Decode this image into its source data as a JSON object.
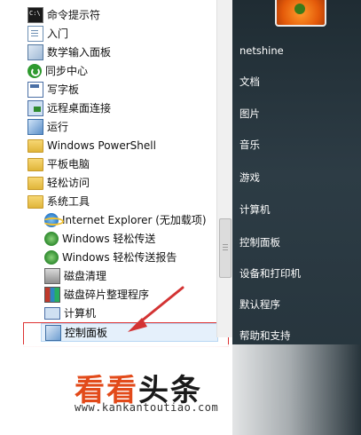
{
  "programs": [
    {
      "label": "命令提示符",
      "icon": "command-prompt-icon"
    },
    {
      "label": "入门",
      "icon": "getting-started-icon"
    },
    {
      "label": "数学输入面板",
      "icon": "math-input-panel-icon"
    },
    {
      "label": "同步中心",
      "icon": "sync-center-icon"
    },
    {
      "label": "写字板",
      "icon": "wordpad-icon"
    },
    {
      "label": "远程桌面连接",
      "icon": "remote-desktop-icon"
    },
    {
      "label": "运行",
      "icon": "run-icon"
    },
    {
      "label": "Windows PowerShell",
      "icon": "folder-icon"
    },
    {
      "label": "平板电脑",
      "icon": "folder-icon"
    },
    {
      "label": "轻松访问",
      "icon": "folder-icon"
    },
    {
      "label": "系统工具",
      "icon": "folder-icon"
    },
    {
      "label": "Internet Explorer (无加载项)",
      "icon": "internet-explorer-icon"
    },
    {
      "label": "Windows 轻松传送",
      "icon": "easy-transfer-icon"
    },
    {
      "label": "Windows 轻松传送报告",
      "icon": "easy-transfer-reports-icon"
    },
    {
      "label": "磁盘清理",
      "icon": "disk-cleanup-icon"
    },
    {
      "label": "磁盘碎片整理程序",
      "icon": "disk-defragmenter-icon"
    },
    {
      "label": "计算机",
      "icon": "computer-icon"
    }
  ],
  "highlighted": {
    "label": "控制面板",
    "icon": "control-panel-icon"
  },
  "right_pane": {
    "user_name": "netshine",
    "items": [
      "文档",
      "图片",
      "音乐",
      "游戏",
      "计算机",
      "控制面板",
      "设备和打印机",
      "默认程序",
      "帮助和支持"
    ]
  },
  "watermark": {
    "logo_part1": "看看",
    "logo_part2": "头条",
    "url": "www.kankantoutiao.com"
  },
  "colors": {
    "accent_red": "#d33333",
    "logo_orange": "#e24a1a",
    "highlight_bg": "#e5f0fb"
  }
}
